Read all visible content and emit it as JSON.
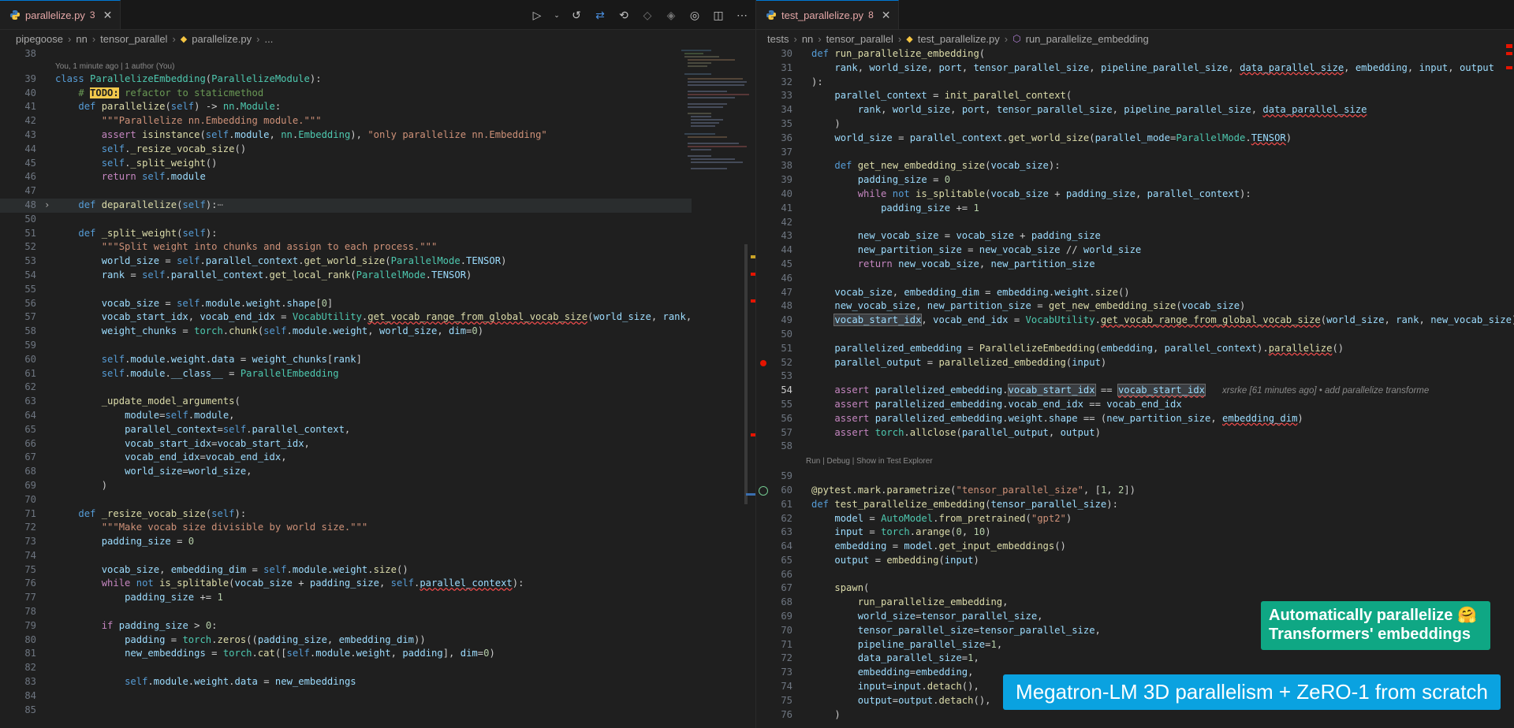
{
  "left": {
    "tab": {
      "filename": "parallelize.py",
      "problems": "3"
    },
    "breadcrumbs": [
      "pipegoose",
      "nn",
      "tensor_parallel",
      "parallelize.py",
      "..."
    ],
    "blame": "You, 1 minute ago | 1 author (You)"
  },
  "right": {
    "tab": {
      "filename": "test_parallelize.py",
      "problems": "8"
    },
    "breadcrumbs": [
      "tests",
      "nn",
      "tensor_parallel",
      "test_parallelize.py",
      "run_parallelize_embedding"
    ],
    "inline_blame": "xrsrke [61 minutes ago] • add parallelize transforme",
    "codelens": "Run | Debug | Show in Test Explorer"
  },
  "banners": {
    "green": "Automatically parallelize 🤗 Transformers' embeddings",
    "blue": "Megatron-LM 3D parallelism + ZeRO-1 from scratch"
  },
  "colors": {
    "accent": "#0078d4",
    "banner_green": "#0fa784",
    "banner_blue": "#0aa2e0",
    "error": "#f14c4c"
  }
}
